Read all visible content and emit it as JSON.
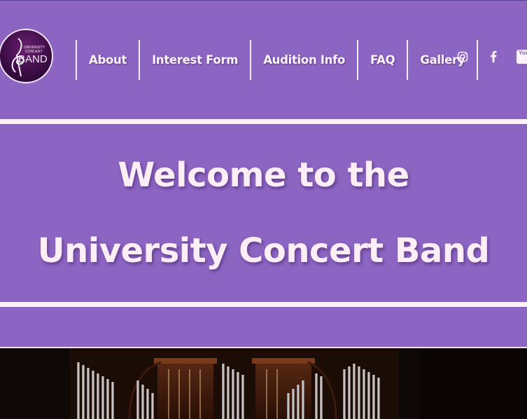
{
  "logo": {
    "alt_text_lines": [
      "UNIVERSITY",
      "CONCERT",
      "BAND"
    ]
  },
  "nav": {
    "items": [
      {
        "label": "About"
      },
      {
        "label": "Interest Form"
      },
      {
        "label": "Audition Info"
      },
      {
        "label": "FAQ"
      },
      {
        "label": "Gallery"
      }
    ]
  },
  "social": {
    "icons": [
      "instagram-icon",
      "facebook-icon",
      "youtube-icon"
    ],
    "youtube_text": "You"
  },
  "hero": {
    "line1": "Welcome to the",
    "line2": "University Concert Band"
  },
  "colors": {
    "background": "#8c64c2",
    "text": "#fbeef6",
    "rule": "#fbf3f8"
  }
}
